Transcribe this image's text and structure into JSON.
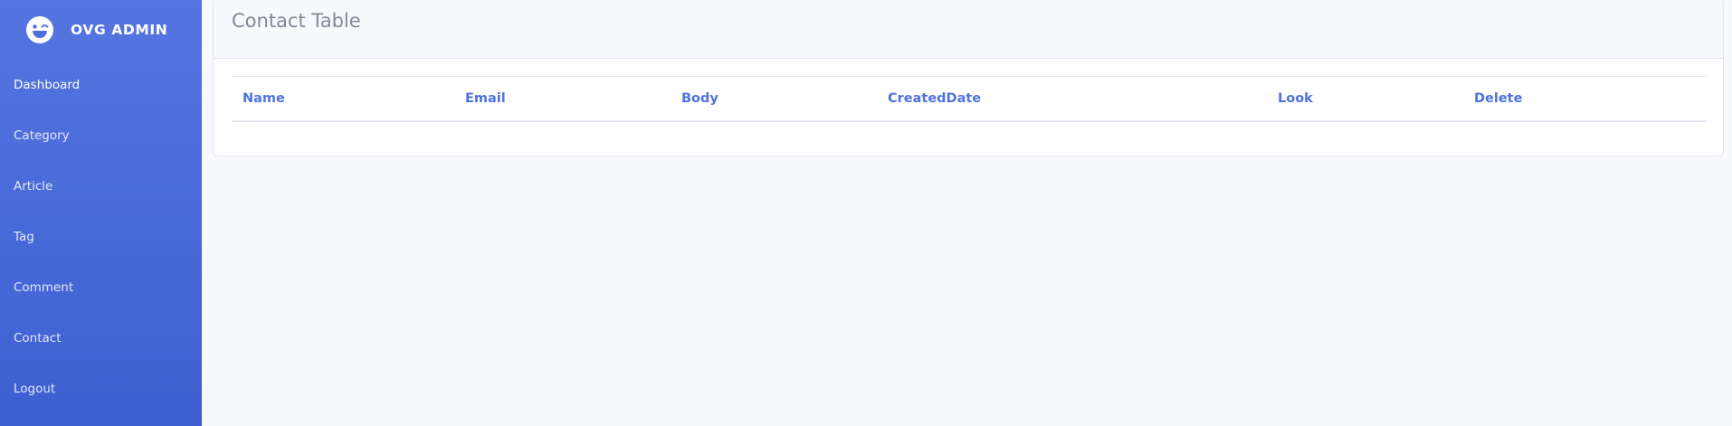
{
  "brand": {
    "name": "OVG ADMIN",
    "logo_icon": "laugh-wink-icon"
  },
  "sidebar": {
    "items": [
      {
        "label": "Dashboard",
        "active": true
      },
      {
        "label": "Category"
      },
      {
        "label": "Article"
      },
      {
        "label": "Tag"
      },
      {
        "label": "Comment"
      },
      {
        "label": "Contact"
      },
      {
        "label": "Logout"
      }
    ]
  },
  "main": {
    "title": "Contact Table",
    "table": {
      "columns": [
        "Name",
        "Email",
        "Body",
        "CreatedDate",
        "Look",
        "Delete"
      ],
      "rows": []
    }
  },
  "colors": {
    "sidebar_gradient_top": "#5575e0",
    "sidebar_gradient_bottom": "#3d5fd1",
    "accent": "#4e73df",
    "page_background": "#f8f9fc",
    "title_text": "#858796",
    "border": "#e3e6f0"
  }
}
